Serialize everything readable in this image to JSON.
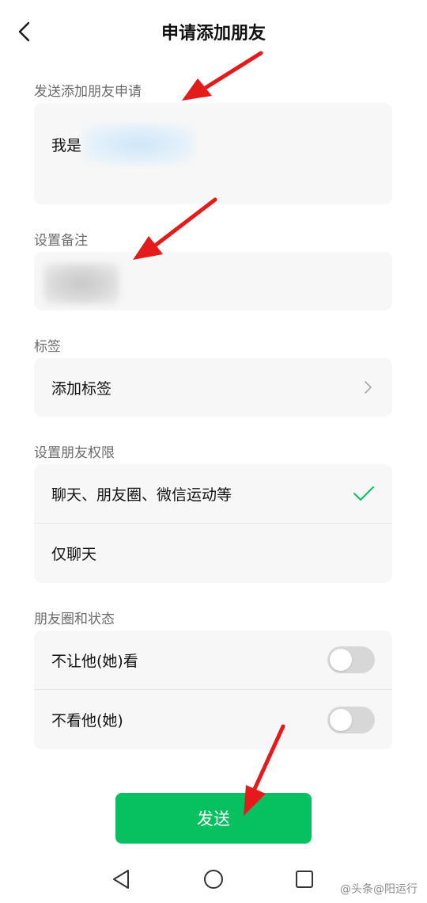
{
  "header": {
    "title": "申请添加朋友"
  },
  "request": {
    "section_label": "发送添加朋友申请",
    "message_prefix": "我是"
  },
  "remark": {
    "section_label": "设置备注"
  },
  "tags": {
    "section_label": "标签",
    "add_label": "添加标签"
  },
  "permissions": {
    "section_label": "设置朋友权限",
    "options": [
      {
        "label": "聊天、朋友圈、微信运动等",
        "selected": true
      },
      {
        "label": "仅聊天",
        "selected": false
      }
    ]
  },
  "moments": {
    "section_label": "朋友圈和状态",
    "toggles": [
      {
        "label": "不让他(她)看",
        "on": false
      },
      {
        "label": "不看他(她)",
        "on": false
      }
    ]
  },
  "send_label": "发送",
  "watermark": "@头条@阳运行",
  "colors": {
    "accent": "#07c160",
    "card": "#f7f7f7",
    "arrow": "#e51b1b"
  }
}
